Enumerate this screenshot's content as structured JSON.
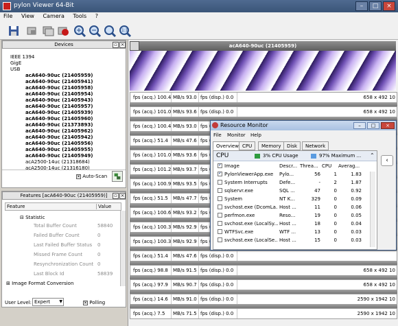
{
  "window": {
    "title": "pylon Viewer 64-Bit"
  },
  "menu": [
    "File",
    "View",
    "Camera",
    "Tools",
    "?"
  ],
  "toolbar": {
    "icons": [
      "save-icon",
      "single-grab-icon",
      "continuous-grab-icon",
      "stop-grab-icon",
      "zoom-in-icon",
      "zoom-out-icon",
      "zoom-fit-icon",
      "zoom-100-icon"
    ]
  },
  "devices": {
    "title": "Devices",
    "tree": [
      {
        "label": "IEEE 1394",
        "level": 1
      },
      {
        "label": "GigE",
        "level": 1
      },
      {
        "label": "USB",
        "level": 1
      },
      {
        "label": "acA640-90uc (21405959)",
        "level": 2,
        "bold": true
      },
      {
        "label": "acA640-90uc (21405941)",
        "level": 2,
        "bold": true
      },
      {
        "label": "acA640-90uc (21405958)",
        "level": 2,
        "bold": true
      },
      {
        "label": "acA640-90uc (21405954)",
        "level": 2,
        "bold": true
      },
      {
        "label": "acA640-90uc (21405943)",
        "level": 2,
        "bold": true
      },
      {
        "label": "acA640-90uc (21405957)",
        "level": 2,
        "bold": true
      },
      {
        "label": "acA640-90uc (21405939)",
        "level": 2,
        "bold": true
      },
      {
        "label": "acA640-90uc (21405960)",
        "level": 2,
        "bold": true
      },
      {
        "label": "acA640-90uc (21373893)",
        "level": 2,
        "bold": true
      },
      {
        "label": "acA640-90uc (21405962)",
        "level": 2,
        "bold": true
      },
      {
        "label": "acA640-90uc (21405942)",
        "level": 2,
        "bold": true
      },
      {
        "label": "acA640-90uc (21405956)",
        "level": 2,
        "bold": true
      },
      {
        "label": "acA640-90uc (21405955)",
        "level": 2,
        "bold": true
      },
      {
        "label": "acA640-90uc (21405949)",
        "level": 2,
        "bold": true
      },
      {
        "label": "acA2500-14uc (21318684)",
        "level": 2,
        "bold": false
      },
      {
        "label": "acA2500-14uc (21316180)",
        "level": 2,
        "bold": false
      }
    ],
    "auto_scan_label": "Auto-Scan"
  },
  "features": {
    "title": "Features [acA640-90uc (21405959)]",
    "col_feature": "Feature",
    "col_value": "Value",
    "group": "Statistic",
    "rows": [
      {
        "name": "Total Buffer Count",
        "value": "58840"
      },
      {
        "name": "Failed Buffer Count",
        "value": "0"
      },
      {
        "name": "Last Failed Buffer Status",
        "value": "0"
      },
      {
        "name": "Missed Frame Count",
        "value": "0"
      },
      {
        "name": "Resynchronization Count",
        "value": "0"
      },
      {
        "name": "Last Block Id",
        "value": "58839"
      }
    ],
    "next_group": "Image Format Conversion",
    "user_level_label": "User Level:",
    "user_level_value": "Expert",
    "polling_label": "Polling"
  },
  "image_window": {
    "title": "acA640-90uc (21405959)"
  },
  "status_rows": [
    {
      "fps_acq": "fps (acq.) 100.4",
      "mbs": "MB/s 93.0",
      "fps_disp": "fps (disp.) 0.0",
      "res": "658 x 492  10"
    },
    {
      "fps_acq": "fps (acq.) 101.0",
      "mbs": "MB/s 93.6",
      "fps_disp": "fps (disp.) 0.0",
      "res": "658 x 492  10"
    },
    {
      "fps_acq": "fps (acq.) 100.4",
      "mbs": "MB/s 93.0",
      "fps_disp": "fps (disp.) 0.0",
      "res": ""
    },
    {
      "fps_acq": "fps (acq.) 51.4",
      "mbs": "MB/s 47.6",
      "fps_disp": "fps (disp.) 0.0",
      "res": ""
    },
    {
      "fps_acq": "fps (acq.) 101.0",
      "mbs": "MB/s 93.6",
      "fps_disp": "fps (disp.) 0.0",
      "res": ""
    },
    {
      "fps_acq": "fps (acq.) 101.2",
      "mbs": "MB/s 93.7",
      "fps_disp": "fps (disp.) 0.0",
      "res": ""
    },
    {
      "fps_acq": "fps (acq.) 100.9",
      "mbs": "MB/s 93.5",
      "fps_disp": "fps (disp.) 0.0",
      "res": ""
    },
    {
      "fps_acq": "fps (acq.) 51.5",
      "mbs": "MB/s 47.7",
      "fps_disp": "fps (disp.) 0.0",
      "res": ""
    },
    {
      "fps_acq": "fps (acq.) 100.6",
      "mbs": "MB/s 93.2",
      "fps_disp": "fps (disp.) 0.0",
      "res": ""
    },
    {
      "fps_acq": "fps (acq.) 100.3",
      "mbs": "MB/s 92.9",
      "fps_disp": "fps (disp.) 0.0",
      "res": ""
    },
    {
      "fps_acq": "fps (acq.) 100.3",
      "mbs": "MB/s 92.9",
      "fps_disp": "fps (disp.) 0.0",
      "res": ""
    },
    {
      "fps_acq": "fps (acq.) 51.4",
      "mbs": "MB/s 47.6",
      "fps_disp": "fps (disp.) 0.0",
      "res": ""
    },
    {
      "fps_acq": "fps (acq.) 98.8",
      "mbs": "MB/s 91.5",
      "fps_disp": "fps (disp.) 0.0",
      "res": "658 x 492  10"
    },
    {
      "fps_acq": "fps (acq.) 97.9",
      "mbs": "MB/s 90.7",
      "fps_disp": "fps (disp.) 0.0",
      "res": "658 x 492  10"
    },
    {
      "fps_acq": "fps (acq.) 14.6",
      "mbs": "MB/s 91.0",
      "fps_disp": "fps (disp.) 0.0",
      "res": "2590 x 1942  10"
    },
    {
      "fps_acq": "fps (acq.) 7.5",
      "mbs": "MB/s 71.5",
      "fps_disp": "fps (disp.) 0.0",
      "res": "2590 x 1942  10"
    }
  ],
  "resource_monitor": {
    "title": "Resource Monitor",
    "menu": [
      "File",
      "Monitor",
      "Help"
    ],
    "tabs": [
      "Overview",
      "CPU",
      "Memory",
      "Disk",
      "Network"
    ],
    "cpu_label": "CPU",
    "cpu_usage": "3% CPU Usage",
    "cpu_max": "97% Maximum ...",
    "columns": [
      "Image",
      "Descr...",
      "Threa...",
      "CPU",
      "Averag..."
    ],
    "rows": [
      {
        "image": "PylonViewerApp.exe",
        "descr": "Pylo...",
        "threads": "56",
        "cpu": "1",
        "avg": "1.83",
        "checked": true
      },
      {
        "image": "System Interrupts",
        "descr": "Defe...",
        "threads": "-",
        "cpu": "2",
        "avg": "1.87",
        "checked": false
      },
      {
        "image": "sqlservr.exe",
        "descr": "SQL ...",
        "threads": "47",
        "cpu": "0",
        "avg": "0.92",
        "checked": false
      },
      {
        "image": "System",
        "descr": "NT K...",
        "threads": "329",
        "cpu": "0",
        "avg": "0.09",
        "checked": false
      },
      {
        "image": "svchost.exe (DcomLa...",
        "descr": "Host ...",
        "threads": "11",
        "cpu": "0",
        "avg": "0.06",
        "checked": false
      },
      {
        "image": "perfmon.exe",
        "descr": "Reso...",
        "threads": "19",
        "cpu": "0",
        "avg": "0.05",
        "checked": false
      },
      {
        "image": "svchost.exe (LocalSy...",
        "descr": "Host ...",
        "threads": "18",
        "cpu": "0",
        "avg": "0.04",
        "checked": false
      },
      {
        "image": "WTFSvc.exe",
        "descr": "WTF ...",
        "threads": "13",
        "cpu": "0",
        "avg": "0.03",
        "checked": false
      },
      {
        "image": "svchost.exe (LocalSe...",
        "descr": "Host ...",
        "threads": "15",
        "cpu": "0",
        "avg": "0.03",
        "checked": false
      }
    ]
  }
}
